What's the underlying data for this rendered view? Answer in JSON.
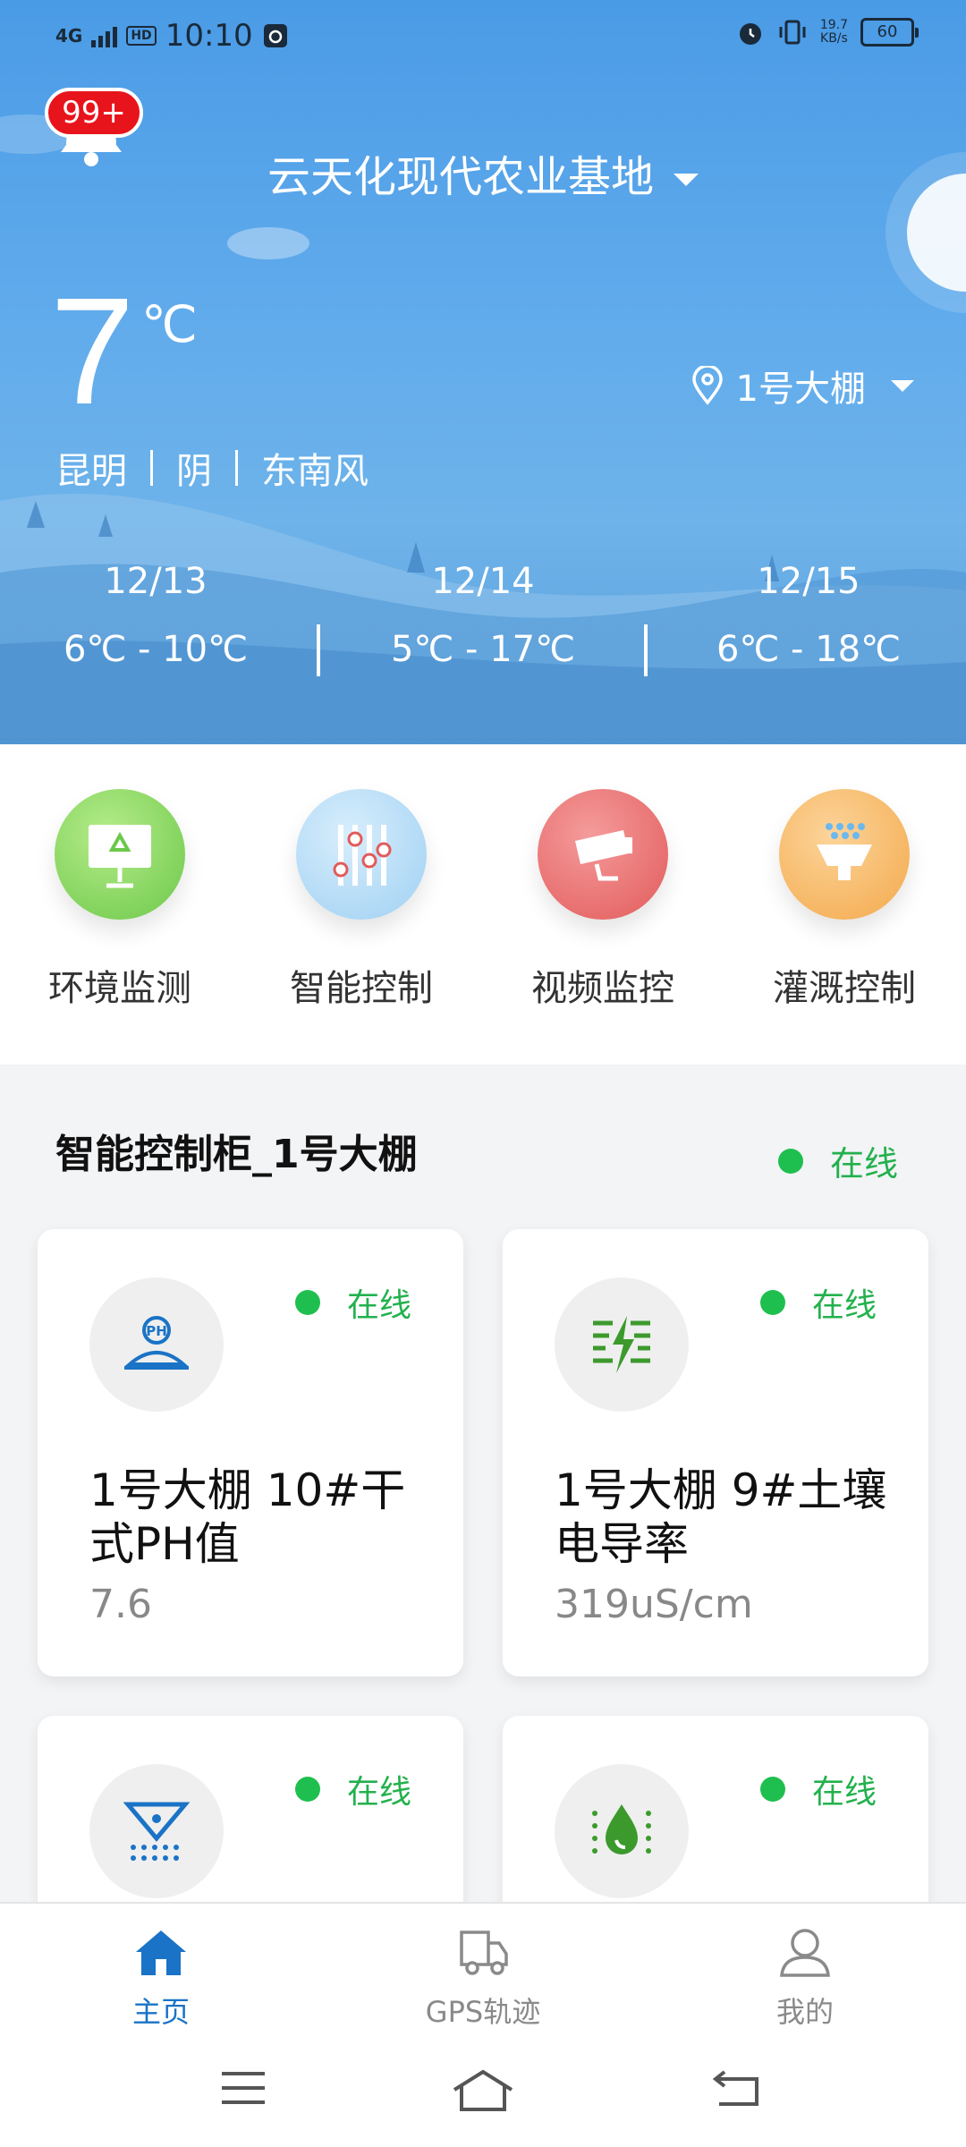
{
  "status_bar": {
    "network": "4G",
    "hd": "HD",
    "time": "10:10",
    "speed_value": "19.7",
    "speed_unit": "KB/s",
    "battery": "60"
  },
  "header": {
    "notification_badge": "99+",
    "base_name": "云天化现代农业基地",
    "temperature": "7",
    "temperature_unit": "℃",
    "city": "昆明",
    "condition": "阴",
    "wind": "东南风",
    "greenhouse": "1号大棚"
  },
  "forecast": [
    {
      "date": "12/13",
      "range": "6℃ - 10℃"
    },
    {
      "date": "12/14",
      "range": "5℃ - 17℃"
    },
    {
      "date": "12/15",
      "range": "6℃ - 18℃"
    }
  ],
  "quick_nav": [
    {
      "label": "环境监测",
      "icon": "environment-monitor-icon",
      "color": "#7fd35a"
    },
    {
      "label": "智能控制",
      "icon": "smart-control-sliders-icon",
      "color": "#a9d8f7"
    },
    {
      "label": "视频监控",
      "icon": "video-camera-icon",
      "color": "#ee6e6e"
    },
    {
      "label": "灌溉控制",
      "icon": "irrigation-sprinkler-icon",
      "color": "#f7b860"
    }
  ],
  "cabinet": {
    "title": "智能控制柜_1号大棚",
    "status": "在线"
  },
  "devices": [
    {
      "name": "1号大棚 10#干式PH值",
      "value": "7.6",
      "status": "在线",
      "icon": "ph-soil-icon"
    },
    {
      "name": "1号大棚 9#土壤电导率",
      "value": "319uS/cm",
      "status": "在线",
      "icon": "conductivity-icon"
    },
    {
      "name": "",
      "value": "",
      "status": "在线",
      "icon": "filter-drip-icon"
    },
    {
      "name": "",
      "value": "",
      "status": "在线",
      "icon": "water-drop-icon"
    }
  ],
  "bottom_nav": {
    "home": "主页",
    "gps": "GPS轨迹",
    "me": "我的",
    "active_color": "#1a73c6"
  }
}
